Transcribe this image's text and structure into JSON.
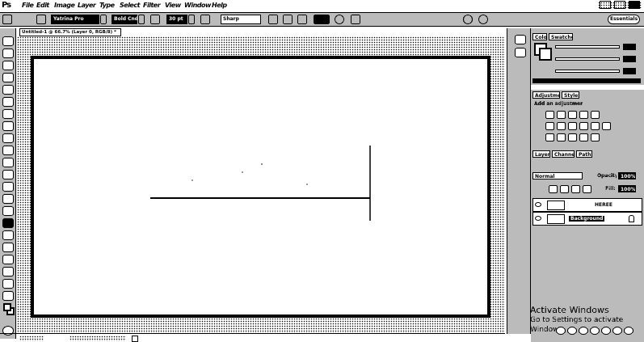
{
  "app": {
    "logo": "Ps"
  },
  "menu": {
    "items": [
      "File",
      "Edit",
      "Image",
      "Layer",
      "Type",
      "Select",
      "Filter",
      "View",
      "Window",
      "Help"
    ]
  },
  "window_controls": [
    "minimize",
    "restore",
    "close"
  ],
  "options_bar": {
    "font_family": "Yatrina Pro",
    "font_style": "Bold Cnd",
    "font_size": "30 pt",
    "antialias": "Sharp"
  },
  "document": {
    "tab_title": "Untitled-1 @ 66.7% (Layer 0, RGB/8) *"
  },
  "workspace_label": "Essentials",
  "panels": {
    "color_tabs": [
      "Color",
      "Swatches"
    ],
    "adjustments_tabs": [
      "Adjustments",
      "Styles"
    ],
    "adjustments_title": "Add an adjustment",
    "layers_tabs": [
      "Layers",
      "Channels",
      "Paths"
    ],
    "blend_mode": "Normal",
    "opacity_label": "Opacity:",
    "opacity_value": "100%",
    "fill_label": "Fill:",
    "fill_value": "100%",
    "layers": [
      {
        "name": "HEREE",
        "type": "text"
      },
      {
        "name": "Background",
        "type": "background",
        "locked": true
      }
    ]
  },
  "status": {
    "zoom": "66.67%",
    "doc_info": "Doc: 1.37M/0 bytes"
  },
  "watermark": {
    "line1": "Activate Windows",
    "line2": "Go to Settings to activate Windows."
  }
}
